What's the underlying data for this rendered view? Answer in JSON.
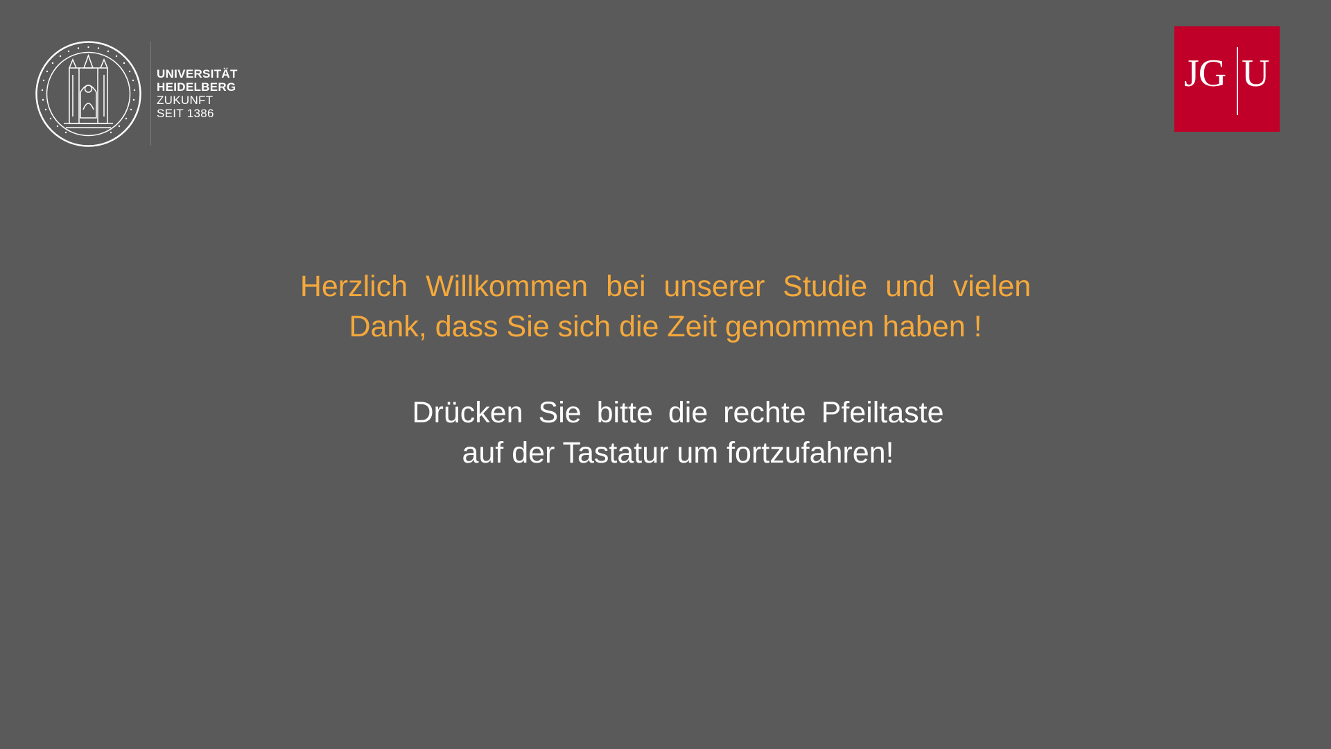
{
  "header": {
    "heidelberg_logo": {
      "line1": "UNIVERSITÄT",
      "line2": "HEIDELBERG",
      "line3": "ZUKUNFT",
      "line4": "SEIT 1386",
      "seal_icon": "heidelberg-seal-icon"
    },
    "jgu_logo": {
      "left": "JG",
      "right": "U",
      "color": "#c1002a"
    }
  },
  "main": {
    "welcome_line1": "Herzlich Willkommen bei unserer Studie und vielen",
    "welcome_line2": "Dank, dass Sie sich die Zeit genommen haben !",
    "instruction_line1": "Drücken Sie bitte die rechte Pfeiltaste",
    "instruction_line2": "auf der Tastatur um fortzufahren!"
  },
  "colors": {
    "background": "#5a5a5a",
    "welcome_text": "#f5a93b",
    "instruction_text": "#ffffff"
  }
}
